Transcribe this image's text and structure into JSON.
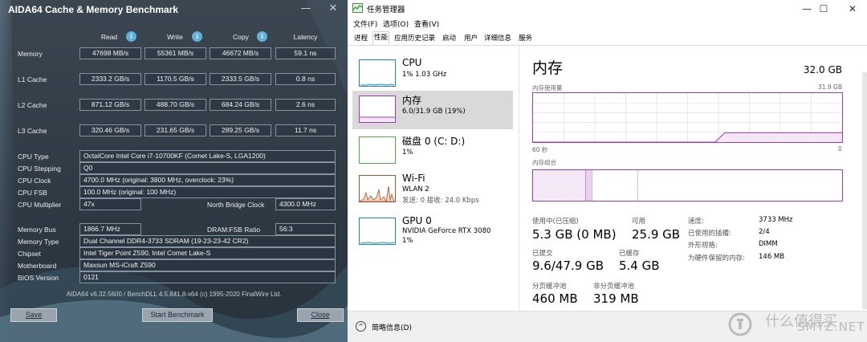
{
  "aida": {
    "title": "AIDA64 Cache & Memory Benchmark",
    "columns": {
      "read": "Read",
      "write": "Write",
      "copy": "Copy",
      "latency": "Latency"
    },
    "rows": [
      {
        "label": "Memory",
        "read": "47698 MB/s",
        "write": "55361 MB/s",
        "copy": "46672 MB/s",
        "latency": "59.1 ns"
      },
      {
        "label": "L1 Cache",
        "read": "2333.2 GB/s",
        "write": "1170.5 GB/s",
        "copy": "2333.5 GB/s",
        "latency": "0.8 ns"
      },
      {
        "label": "L2 Cache",
        "read": "871.12 GB/s",
        "write": "488.70 GB/s",
        "copy": "684.24 GB/s",
        "latency": "2.6 ns"
      },
      {
        "label": "L3 Cache",
        "read": "320.46 GB/s",
        "write": "231.65 GB/s",
        "copy": "289.25 GB/s",
        "latency": "11.7 ns"
      }
    ],
    "info": [
      {
        "label": "CPU Type",
        "value": "OctalCore Intel Core i7-10700KF  (Comet Lake-S, LGA1200)"
      },
      {
        "label": "CPU Stepping",
        "value": "Q0"
      },
      {
        "label": "CPU Clock",
        "value": "4700.0 MHz  (original: 3800 MHz, overclock: 23%)"
      },
      {
        "label": "CPU FSB",
        "value": "100.0 MHz  (original: 100 MHz)"
      },
      {
        "label": "CPU Multiplier",
        "value": "47x"
      }
    ],
    "nb_label": "North Bridge Clock",
    "nb_value": "4300.0 MHz",
    "mem_info": {
      "bus_label": "Memory Bus",
      "bus_value": "1866.7 MHz",
      "ratio_label": "DRAM:FSB Ratio",
      "ratio_value": "56:3",
      "type_label": "Memory Type",
      "type_value": "Dual Channel DDR4-3733 SDRAM  (19-23-23-42 CR2)",
      "chipset_label": "Chipset",
      "chipset_value": "Intel Tiger Point Z590, Intel Comet Lake-S",
      "mb_label": "Motherboard",
      "mb_value": "Maxsun MS-iCraft Z590",
      "bios_label": "BIOS Version",
      "bios_value": "0121"
    },
    "footer": "AIDA64 v6.32.5600 / BenchDLL 4.5.841.8-x64  (c) 1995-2020 FinalWire Ltd.",
    "save": "Save",
    "start": "Start Benchmark",
    "close": "Close",
    "minimize_glyph": "—",
    "close_glyph": "✕"
  },
  "tm": {
    "title": "任务管理器",
    "menu": [
      "文件(F)",
      "选项(O)",
      "查看(V)"
    ],
    "tabs": [
      "进程",
      "性能",
      "应用历史记录",
      "启动",
      "用户",
      "详细信息",
      "服务"
    ],
    "active_tab_index": 1,
    "controls": {
      "minimize": "—",
      "maximize": "☐",
      "close": "✕"
    },
    "sidebar": [
      {
        "name": "CPU",
        "sub1": "1%  1.03 GHz",
        "sub2": "",
        "color": "#1a86c8"
      },
      {
        "name": "内存",
        "sub1": "6.0/31.9 GB (19%)",
        "sub2": "",
        "color": "#9b3cb0"
      },
      {
        "name": "磁盘 0 (C: D:)",
        "sub1": "1%",
        "sub2": "",
        "color": "#4caf3f"
      },
      {
        "name": "Wi-Fi",
        "sub1": "WLAN 2",
        "sub2": "发送: 0 接收: 24.0 Kbps",
        "color": "#a9552a"
      },
      {
        "name": "GPU 0",
        "sub1": "NVIDIA GeForce RTX 3080",
        "sub2": "1%",
        "color": "#1a86c8"
      }
    ],
    "main": {
      "title": "内存",
      "total": "32.0 GB",
      "usage_label": "内存使用量",
      "usage_max": "31.9 GB",
      "time_left": "60 秒",
      "time_right": "0",
      "usage_level": 0.19,
      "composition_label": "内存组合",
      "stats": {
        "in_use_label": "使用中(已压缩)",
        "in_use_value": "5.3 GB (0 MB)",
        "available_label": "可用",
        "available_value": "25.9 GB",
        "committed_label": "已提交",
        "committed_value": "9.6/47.9 GB",
        "cached_label": "已缓存",
        "cached_value": "5.4 GB",
        "paged_label": "分页缓冲池",
        "paged_value": "460 MB",
        "nonpaged_label": "非分页缓冲池",
        "nonpaged_value": "319 MB",
        "speed_label": "速度:",
        "speed_value": "3733 MHz",
        "slots_label": "已使用的插槽:",
        "slots_value": "2/4",
        "form_label": "外形规格:",
        "form_value": "DIMM",
        "reserved_label": "为硬件保留的内存:",
        "reserved_value": "146 MB"
      }
    },
    "fewer_details": "简略信息(D)",
    "fewer_icon": "^",
    "watermark_text": "什么值得买",
    "watermark_sub": "SMYZ.NET"
  }
}
